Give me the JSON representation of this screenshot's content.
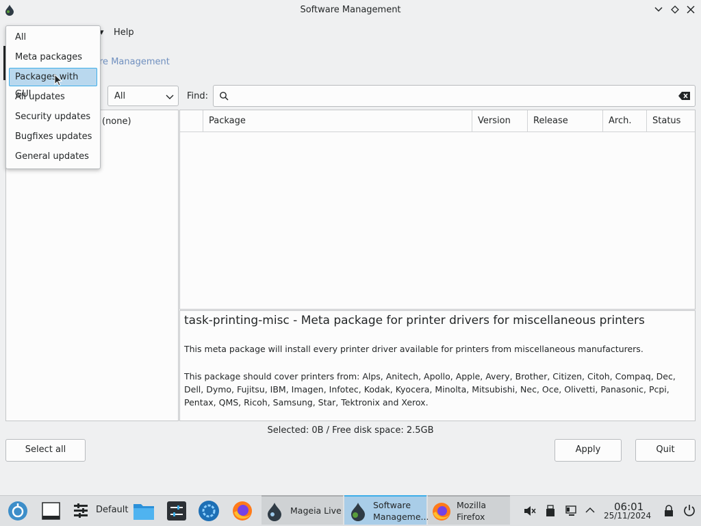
{
  "window": {
    "title": "Software Management"
  },
  "menubar": {
    "help": "Help"
  },
  "breadcrumb": "re Management",
  "filter": {
    "selected": "All"
  },
  "find": {
    "label": "Find:",
    "value": ""
  },
  "left_panel": {
    "item": "(none)"
  },
  "table": {
    "columns": [
      "Package",
      "Version",
      "Release",
      "Arch.",
      "Status"
    ]
  },
  "description": {
    "title": "task-printing-misc - Meta package for printer drivers for miscellaneous printers",
    "p1": "This meta package will install every printer driver available for printers from miscellaneous manufacturers.",
    "p2": "This package should cover printers from: Alps, Anitech, Apollo, Apple, Avery, Brother, Citizen, Citoh, Compaq, Dec, Dell, Dymo, Fujitsu, IBM, Imagen, Infotec, Kodak, Kyocera, Minolta, Mitsubishi, Nec, Oce, Olivetti, Panasonic, Pcpi, Pentax, QMS, Ricoh, Samsung, Star, Tektronix and Xerox."
  },
  "status": "Selected: 0B / Free disk space: 2.5GB",
  "buttons": {
    "select_all": "Select all",
    "apply": "Apply",
    "quit": "Quit"
  },
  "dropdown": {
    "items": [
      "All",
      "Meta packages",
      "Packages with GUI",
      "All updates",
      "Security updates",
      "Bugfixes updates",
      "General updates"
    ],
    "highlighted": "Packages with GUI"
  },
  "taskbar": {
    "default_label": "Default",
    "tasks": [
      "Mageia Live",
      "Software Manageme...",
      "Mozilla Firefox"
    ],
    "task_lines": [
      [
        "Mageia Live"
      ],
      [
        "Software",
        "Manageme..."
      ],
      [
        "Mozilla",
        "Firefox"
      ]
    ],
    "clock_time": "06:01",
    "clock_date": "25/11/2024"
  },
  "colors": {
    "accent": "#3daee9",
    "selection": "#b9d8ee",
    "link": "#6f8fbf"
  }
}
